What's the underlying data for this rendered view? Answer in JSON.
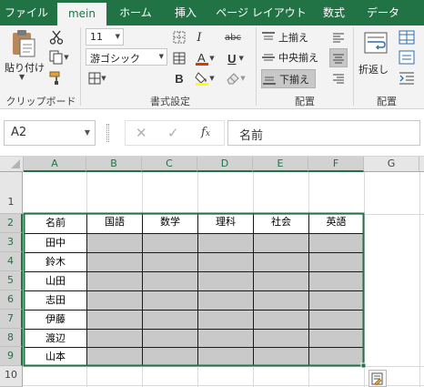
{
  "tabs": [
    "ファイル",
    "mein",
    "ホーム",
    "挿入",
    "ページ レイアウト",
    "数式",
    "データ"
  ],
  "ribbon": {
    "paste_label": "貼り付け",
    "clipboard_label": "クリップボード",
    "font_size": "11",
    "font_name": "游ゴシック",
    "font_group_label": "書式設定",
    "align_top_label": "上揃え",
    "align_middle_label": "中央揃え",
    "align_bottom_label": "下揃え",
    "align_group_label": "配置",
    "wrap_label": "折返し",
    "wrap_group_label": "配置",
    "font_color": "#d83b01",
    "fill_color": "#ffff00"
  },
  "formula_bar": {
    "name_box": "A2",
    "content": "名前"
  },
  "sheet": {
    "columns": [
      "A",
      "B",
      "C",
      "D",
      "E",
      "F",
      "G"
    ],
    "rows": [
      "1",
      "2",
      "3",
      "4",
      "5",
      "6",
      "7",
      "8",
      "9",
      "10"
    ],
    "selected_columns": [
      "A",
      "B",
      "C",
      "D",
      "E",
      "F"
    ],
    "selected_rows": [
      "2",
      "3",
      "4",
      "5",
      "6",
      "7",
      "8",
      "9"
    ],
    "header_row": [
      "名前",
      "国語",
      "数学",
      "理科",
      "社会",
      "英語"
    ],
    "names": [
      "田中",
      "鈴木",
      "山田",
      "志田",
      "伊藤",
      "渡辺",
      "山本"
    ],
    "selection_color": "#217346",
    "shaded_color": "#c9c9c9"
  }
}
